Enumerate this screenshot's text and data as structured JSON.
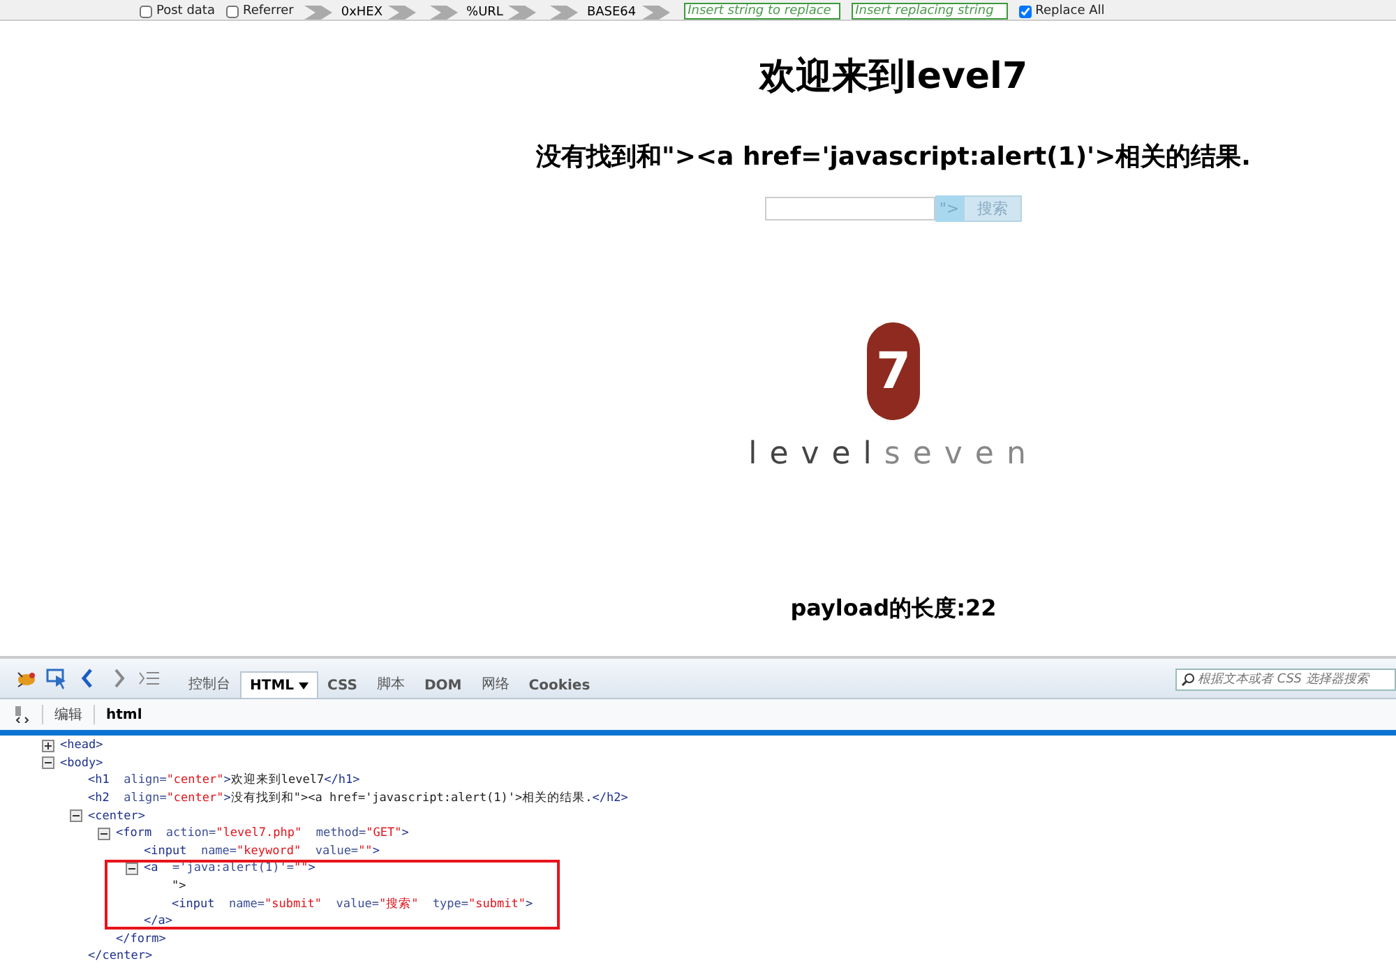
{
  "addon_toolbar": {
    "items": [
      {
        "kind": "checkbox",
        "label": "Post data",
        "checked": false
      },
      {
        "kind": "checkbox",
        "label": "Referrer",
        "checked": false
      },
      {
        "kind": "encoder",
        "label": "0xHEX"
      },
      {
        "kind": "encoder",
        "label": "%URL"
      },
      {
        "kind": "encoder",
        "label": "BASE64"
      },
      {
        "kind": "field",
        "placeholder": "Insert string to replace"
      },
      {
        "kind": "field",
        "placeholder": "Insert replacing string"
      },
      {
        "kind": "checkbox",
        "label": "Replace All",
        "checked": true
      }
    ]
  },
  "page": {
    "heading": "欢迎来到level7",
    "result_prefix": "没有找到和\"><a href='javascript:alert(1)'>相关的结果.",
    "form": {
      "injected_text": "\">",
      "submit_label": "搜索"
    },
    "logo": {
      "digit": "7",
      "word_dark": "level",
      "word_light": "seven"
    },
    "payload_length": "payload的长度:22"
  },
  "devtools": {
    "tabs": [
      {
        "label": "控制台",
        "selected": false,
        "menu": false
      },
      {
        "label": "HTML",
        "selected": true,
        "menu": true
      },
      {
        "label": "CSS",
        "selected": false,
        "menu": false
      },
      {
        "label": "脚本",
        "selected": false,
        "menu": false
      },
      {
        "label": "DOM",
        "selected": false,
        "menu": false
      },
      {
        "label": "网络",
        "selected": false,
        "menu": false
      },
      {
        "label": "Cookies",
        "selected": false,
        "menu": false
      }
    ],
    "search": {
      "placeholder": "根据文本或者 CSS 选择器搜索"
    },
    "edit_label": "编辑",
    "breadcrumb": "html",
    "tree": [
      {
        "expanded": false,
        "segments": [
          {
            "kind": "tag",
            "text": "<head>"
          }
        ]
      },
      {
        "expanded": true,
        "segments": [
          {
            "kind": "tag",
            "text": "<body>"
          }
        ],
        "children": [
          {
            "segments": [
              {
                "kind": "tag",
                "text": "<h1 "
              },
              {
                "kind": "attr",
                "text": " align="
              },
              {
                "kind": "value",
                "text": "\"center\""
              },
              {
                "kind": "tag",
                "text": ">"
              },
              {
                "kind": "text",
                "text": "欢迎来到level7"
              },
              {
                "kind": "tag",
                "text": "</h1>"
              }
            ]
          },
          {
            "segments": [
              {
                "kind": "tag",
                "text": "<h2 "
              },
              {
                "kind": "attr",
                "text": " align="
              },
              {
                "kind": "value",
                "text": "\"center\""
              },
              {
                "kind": "tag",
                "text": ">"
              },
              {
                "kind": "text",
                "text": "没有找到和\"><a href='javascript:alert(1)'>相关的结果."
              },
              {
                "kind": "tag",
                "text": "</h2>"
              }
            ]
          },
          {
            "expanded": true,
            "segments": [
              {
                "kind": "tag",
                "text": "<center>"
              }
            ],
            "closing": [
              {
                "kind": "tag",
                "text": "</center>"
              }
            ],
            "children": [
              {
                "expanded": true,
                "segments": [
                  {
                    "kind": "tag",
                    "text": "<form "
                  },
                  {
                    "kind": "attr",
                    "text": " action="
                  },
                  {
                    "kind": "value",
                    "text": "\"level7.php\""
                  },
                  {
                    "kind": "attr",
                    "text": "  method="
                  },
                  {
                    "kind": "value",
                    "text": "\"GET\""
                  },
                  {
                    "kind": "tag",
                    "text": ">"
                  }
                ],
                "closing": [
                  {
                    "kind": "tag",
                    "text": "</form>"
                  }
                ],
                "children": [
                  {
                    "segments": [
                      {
                        "kind": "tag",
                        "text": "<input "
                      },
                      {
                        "kind": "attr",
                        "text": " name="
                      },
                      {
                        "kind": "value",
                        "text": "\"keyword\""
                      },
                      {
                        "kind": "attr",
                        "text": "  value="
                      },
                      {
                        "kind": "value",
                        "text": "\"\""
                      },
                      {
                        "kind": "tag",
                        "text": ">"
                      }
                    ]
                  },
                  {
                    "expanded": true,
                    "segments": [
                      {
                        "kind": "tag",
                        "text": "<a "
                      },
                      {
                        "kind": "attr",
                        "text": " ='java:alert(1)'="
                      },
                      {
                        "kind": "value",
                        "text": "\"\""
                      },
                      {
                        "kind": "tag",
                        "text": ">"
                      }
                    ],
                    "closing": [
                      {
                        "kind": "tag",
                        "text": "</a>"
                      }
                    ],
                    "children": [
                      {
                        "segments": [
                          {
                            "kind": "text",
                            "text": "\">"
                          }
                        ]
                      },
                      {
                        "segments": [
                          {
                            "kind": "tag",
                            "text": "<input "
                          },
                          {
                            "kind": "attr",
                            "text": " name="
                          },
                          {
                            "kind": "value",
                            "text": "\"submit\""
                          },
                          {
                            "kind": "attr",
                            "text": "  value="
                          },
                          {
                            "kind": "value",
                            "text": "\"搜索\""
                          },
                          {
                            "kind": "attr",
                            "text": "  type="
                          },
                          {
                            "kind": "value",
                            "text": "\"submit\""
                          },
                          {
                            "kind": "tag",
                            "text": ">"
                          }
                        ]
                      }
                    ]
                  }
                ]
              }
            ]
          }
        ]
      }
    ]
  }
}
